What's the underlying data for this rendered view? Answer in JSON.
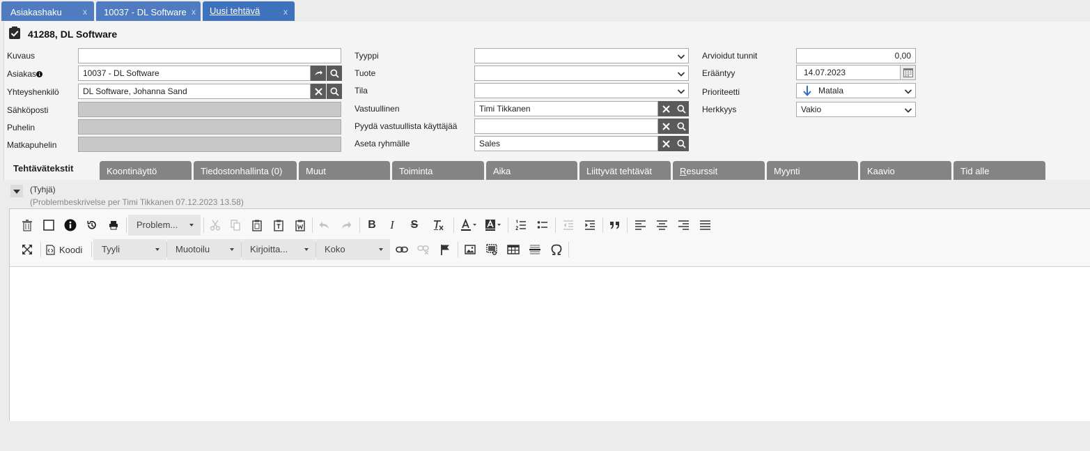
{
  "doc_tabs": [
    {
      "label": "Asiakashaku",
      "close": "x"
    },
    {
      "label": "10037 - DL Software",
      "close": "x"
    },
    {
      "label": "Uusi tehtävä",
      "close": "x"
    }
  ],
  "header": {
    "title": "41288, DL Software",
    "icon": "task-clipboard-icon"
  },
  "left_fields": {
    "kuvaus": {
      "label": "Kuvaus",
      "value": ""
    },
    "asiakas": {
      "label": "Asiakas",
      "value": "10037 - DL Software"
    },
    "yhteyshenkilo": {
      "label": "Yhteyshenkilö",
      "value": "DL Software, Johanna Sand"
    },
    "sahkoposti": {
      "label": "Sähköposti",
      "value": ""
    },
    "puhelin": {
      "label": "Puhelin",
      "value": ""
    },
    "matkapuhelin": {
      "label": "Matkapuhelin",
      "value": ""
    }
  },
  "mid_fields": {
    "tyyppi": {
      "label": "Tyyppi",
      "value": ""
    },
    "tuote": {
      "label": "Tuote",
      "value": ""
    },
    "tila": {
      "label": "Tila",
      "value": ""
    },
    "vastuullinen": {
      "label": "Vastuullinen",
      "value": "Timi Tikkanen"
    },
    "pyyda": {
      "label": "Pyydä vastuullista käyttäjää",
      "value": ""
    },
    "ryhma": {
      "label": "Aseta ryhmälle",
      "value": "Sales"
    }
  },
  "right_fields": {
    "tunnit": {
      "label": "Arvioidut tunnit",
      "value": "0,00"
    },
    "eraantyy": {
      "label": "Erääntyy",
      "value": "14.07.2023"
    },
    "prioriteetti": {
      "label": "Prioriteetti",
      "value": "Matala"
    },
    "herkkyys": {
      "label": "Herkkyys",
      "value": "Vakio"
    }
  },
  "section_tabs": [
    {
      "label": "Tehtävätekstit"
    },
    {
      "label": "Koontinäyttö"
    },
    {
      "label": "Tiedostonhallinta (0)"
    },
    {
      "label": "Muut"
    },
    {
      "label": "Toiminta"
    },
    {
      "label": "Aika"
    },
    {
      "label": "Liittyvät tehtävät"
    },
    {
      "label_first": "R",
      "label_rest": "esurssit"
    },
    {
      "label": "Myynti"
    },
    {
      "label": "Kaavio"
    },
    {
      "label": "Tid alle"
    }
  ],
  "notes": {
    "empty": "(Tyhjä)",
    "meta": "(Problembeskrivelse per Timi Tikkanen 07.12.2023 13.58)"
  },
  "toolbar": {
    "template_combo": "Problem...",
    "code_label": "Koodi",
    "style_combo": "Tyyli",
    "format_combo": "Muotoilu",
    "font_combo": "Kirjoitta...",
    "size_combo": "Koko"
  },
  "colors": {
    "tab_blue": "#4f7cc0",
    "section_tab_gray": "#848484",
    "priority_arrow": "#2f6fc2"
  }
}
